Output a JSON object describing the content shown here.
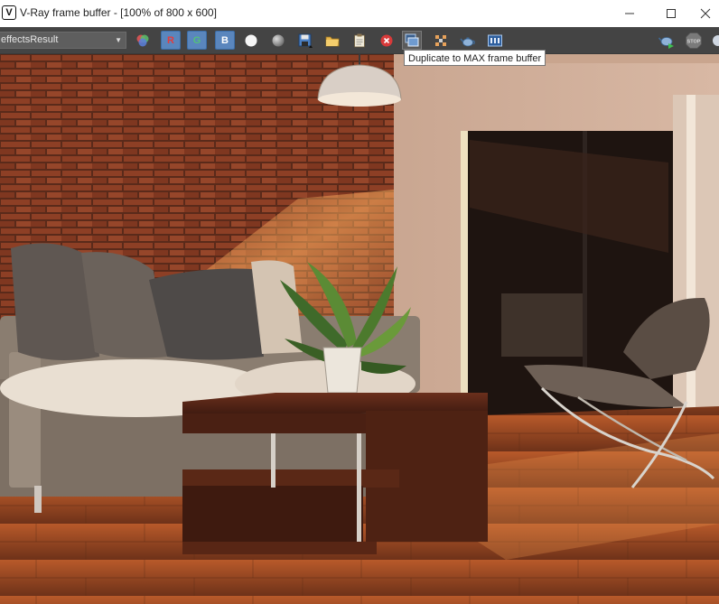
{
  "window": {
    "title": "V-Ray frame buffer - [100% of 800 x 600]",
    "app_icon_glyph": "V",
    "controls": {
      "minimize": "minimize-icon",
      "maximize": "maximize-icon",
      "close": "close-icon"
    }
  },
  "toolbar": {
    "channel": {
      "selected": "effectsResult"
    },
    "buttons": {
      "color_channels": "color-channels-icon",
      "red": "R",
      "green": "G",
      "blue": "B",
      "mono": "white-circle-icon",
      "alpha": "grey-circle-icon",
      "save": "save-icon",
      "load": "folder-icon",
      "clear": "clipboard-icon",
      "stop_clear": "red-x-icon",
      "duplicate": "duplicate-to-max-icon",
      "region": "region-render-icon",
      "render_teapot": "teapot-icon",
      "history": "history-icon",
      "render": "render-teapot-icon",
      "stop": "STOP"
    }
  },
  "tooltip": {
    "text": "Duplicate to MAX frame buffer"
  },
  "colors": {
    "toolbar_bg": "#444444",
    "rgb_button": "#5a86bd",
    "red_letter": "#e53b3b",
    "green_letter": "#54c07a",
    "blue_letter": "#ffffff",
    "brick": "#8c3d22",
    "wall": "#b48a72",
    "floor": "#9a4a26"
  }
}
